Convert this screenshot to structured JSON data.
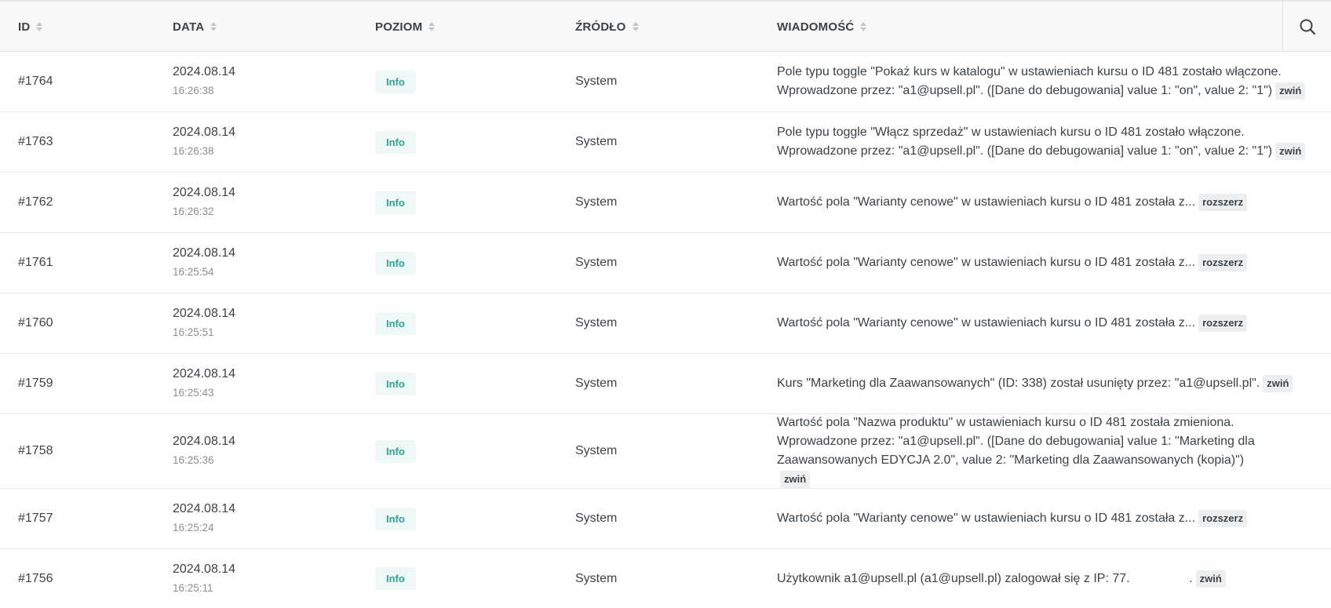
{
  "table": {
    "columns": [
      {
        "label": "ID"
      },
      {
        "label": "DATA"
      },
      {
        "label": "POZIOM"
      },
      {
        "label": "ŹRÓDŁO"
      },
      {
        "label": "WIADOMOŚĆ"
      }
    ],
    "search_icon": "search-icon",
    "badge_color": "#2aa596",
    "rows": [
      {
        "id": "#1764",
        "date": "2024.08.14",
        "time": "16:26:38",
        "level": "Info",
        "source": "System",
        "message": "Pole typu toggle \"Pokaż kurs w katalogu\" w ustawieniach kursu o ID 481 zostało włączone. Wprowadzone przez: \"a1@upsell.pl\". ([Dane do debugowania] value 1: \"on\", value 2: \"1\")",
        "toggle": "zwiń"
      },
      {
        "id": "#1763",
        "date": "2024.08.14",
        "time": "16:26:38",
        "level": "Info",
        "source": "System",
        "message": "Pole typu toggle \"Włącz sprzedaż\" w ustawieniach kursu o ID 481 zostało włączone. Wprowadzone przez: \"a1@upsell.pl\". ([Dane do debugowania] value 1: \"on\", value 2: \"1\")",
        "toggle": "zwiń"
      },
      {
        "id": "#1762",
        "date": "2024.08.14",
        "time": "16:26:32",
        "level": "Info",
        "source": "System",
        "message": "Wartość pola \"Warianty cenowe\" w ustawieniach kursu o ID 481 została z...",
        "toggle": "rozszerz"
      },
      {
        "id": "#1761",
        "date": "2024.08.14",
        "time": "16:25:54",
        "level": "Info",
        "source": "System",
        "message": "Wartość pola \"Warianty cenowe\" w ustawieniach kursu o ID 481 została z...",
        "toggle": "rozszerz"
      },
      {
        "id": "#1760",
        "date": "2024.08.14",
        "time": "16:25:51",
        "level": "Info",
        "source": "System",
        "message": "Wartość pola \"Warianty cenowe\" w ustawieniach kursu o ID 481 została z...",
        "toggle": "rozszerz"
      },
      {
        "id": "#1759",
        "date": "2024.08.14",
        "time": "16:25:43",
        "level": "Info",
        "source": "System",
        "message": "Kurs \"Marketing dla Zaawansowanych\" (ID: 338) został usunięty przez: \"a1@upsell.pl\".",
        "toggle": "zwiń"
      },
      {
        "id": "#1758",
        "date": "2024.08.14",
        "time": "16:25:36",
        "level": "Info",
        "source": "System",
        "message": "Wartość pola \"Nazwa produktu\" w ustawieniach kursu o ID 481 została zmieniona. Wprowadzone przez: \"a1@upsell.pl\". ([Dane do debugowania] value 1: \"Marketing dla Zaawansowanych EDYCJA 2.0\", value 2: \"Marketing dla Zaawansowanych (kopia)\")",
        "toggle": "zwiń"
      },
      {
        "id": "#1757",
        "date": "2024.08.14",
        "time": "16:25:24",
        "level": "Info",
        "source": "System",
        "message": "Wartość pola \"Warianty cenowe\" w ustawieniach kursu o ID 481 została z...",
        "toggle": "rozszerz"
      },
      {
        "id": "#1756",
        "date": "2024.08.14",
        "time": "16:25:11",
        "level": "Info",
        "source": "System",
        "message": "Użytkownik a1@upsell.pl (a1@upsell.pl) zalogował się z IP: 77.                 .",
        "toggle": "zwiń"
      }
    ]
  }
}
